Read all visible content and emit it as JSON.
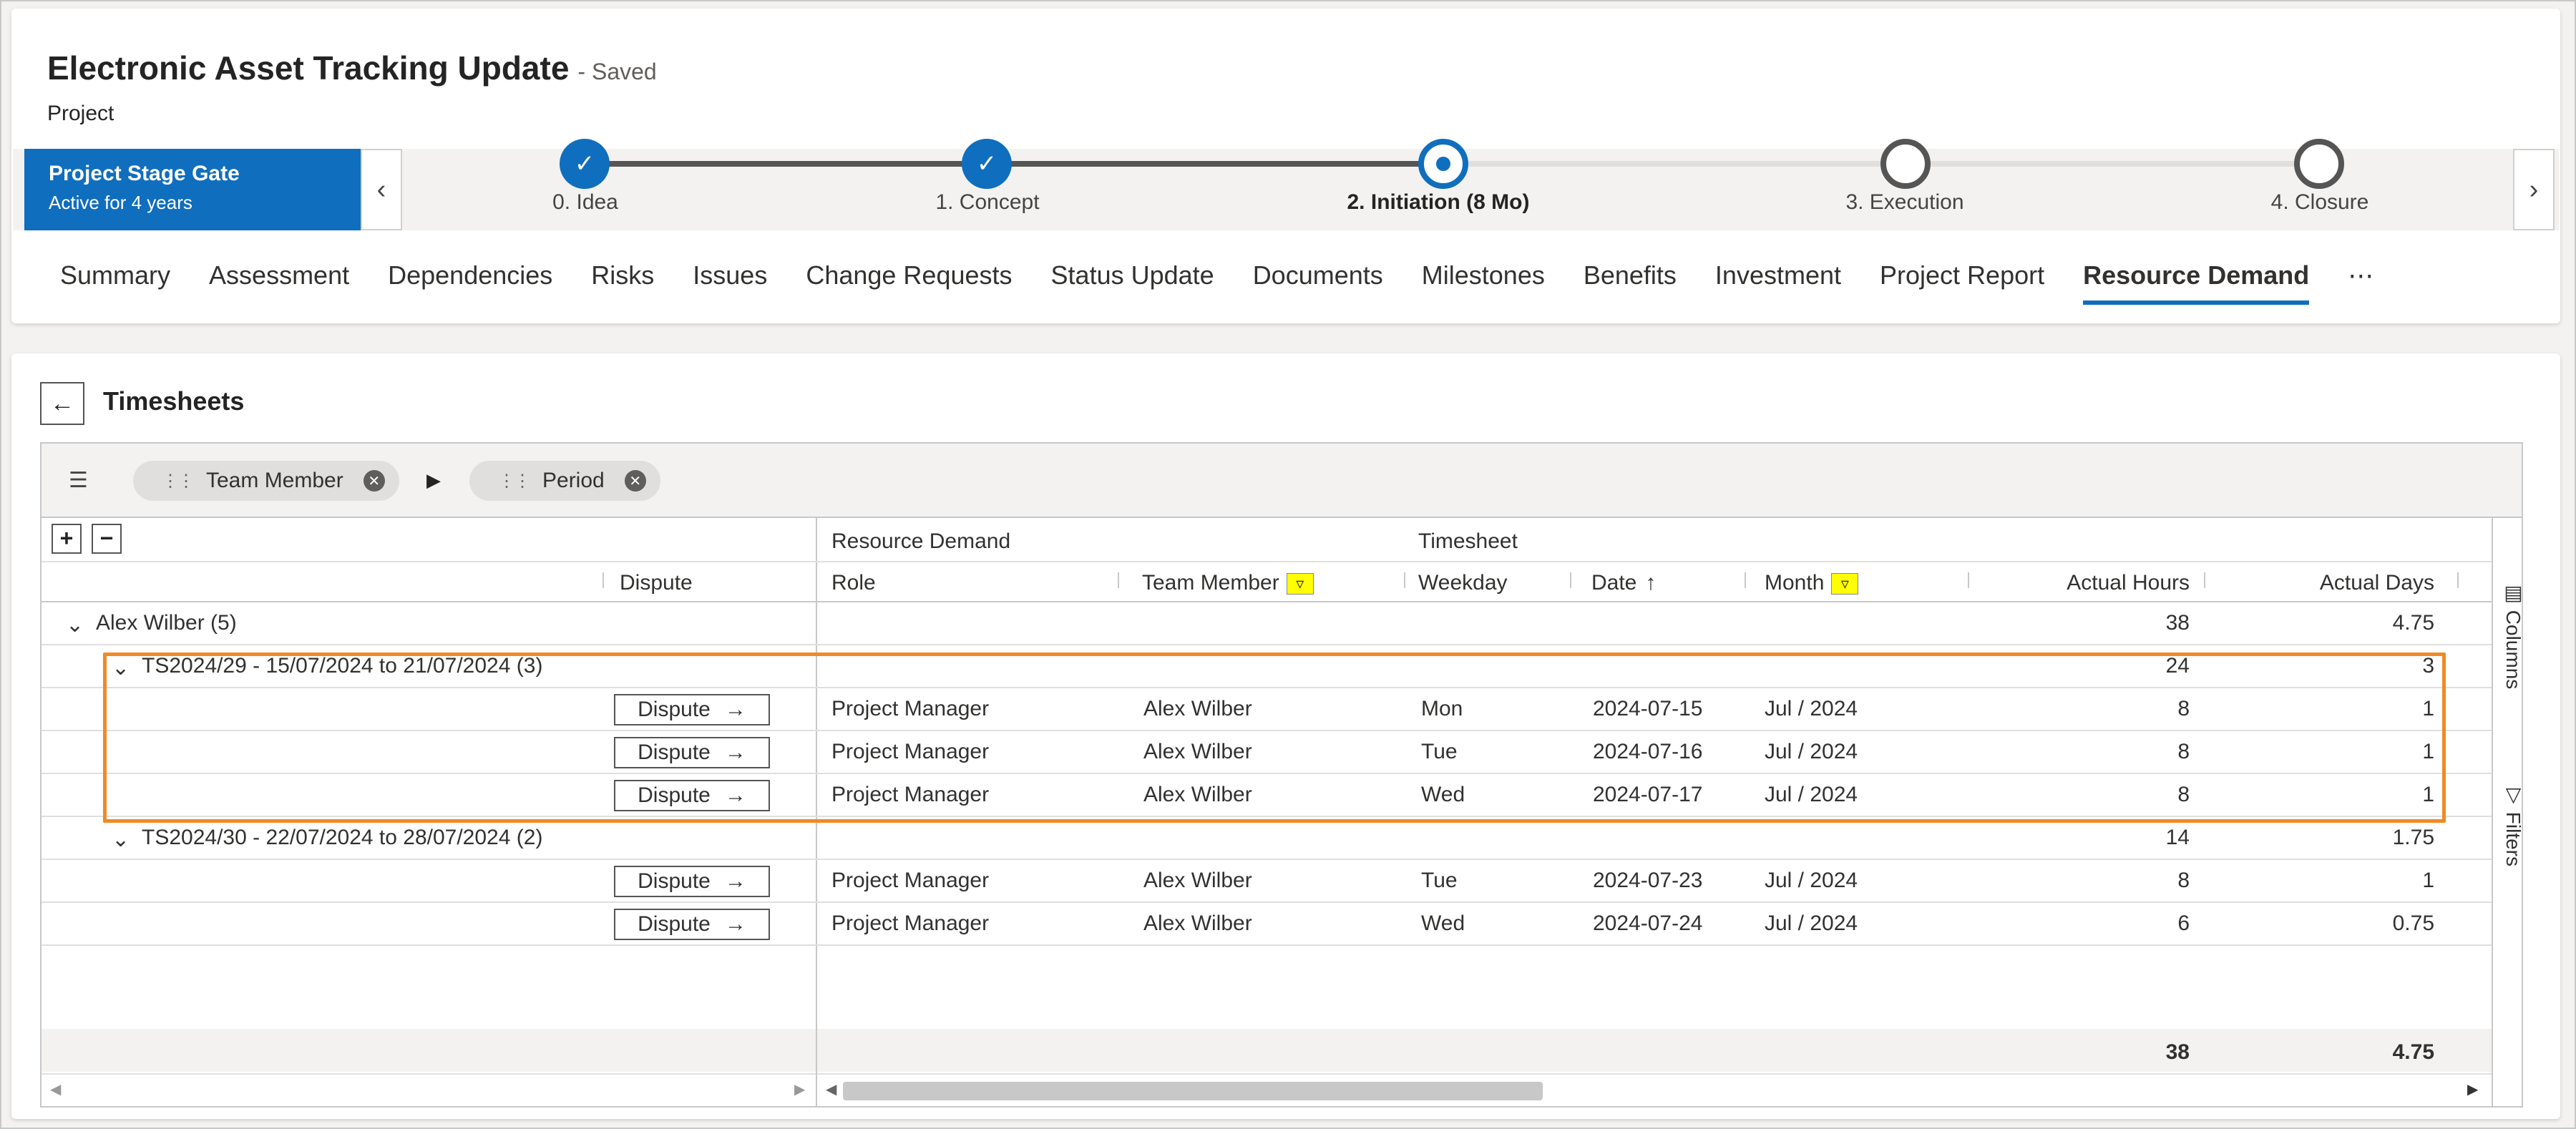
{
  "header": {
    "title": "Electronic Asset Tracking Update",
    "save_status": "- Saved",
    "entity": "Project"
  },
  "bpf": {
    "name": "Project Stage Gate",
    "active_for": "Active for 4 years",
    "prev_icon": "chevron-left-icon",
    "next_icon": "chevron-right-icon",
    "stages": [
      {
        "label": "0. Idea",
        "state": "done"
      },
      {
        "label": "1. Concept",
        "state": "done"
      },
      {
        "label": "2. Initiation  (8 Mo)",
        "state": "active"
      },
      {
        "label": "3. Execution",
        "state": "todo"
      },
      {
        "label": "4. Closure",
        "state": "todo"
      }
    ]
  },
  "tabs": [
    "Summary",
    "Assessment",
    "Dependencies",
    "Risks",
    "Issues",
    "Change Requests",
    "Status Update",
    "Documents",
    "Milestones",
    "Benefits",
    "Investment",
    "Project Report",
    "Resource Demand",
    "⋯"
  ],
  "active_tab": "Resource Demand",
  "section": {
    "back_icon": "arrow-left-icon",
    "title": "Timesheets"
  },
  "grouping": {
    "icon": "group-list-icon",
    "chips": [
      "Team Member",
      "Period"
    ]
  },
  "grid": {
    "expand_all": "+",
    "collapse_all": "−",
    "group_headers": {
      "resource_demand": "Resource Demand",
      "timesheet": "Timesheet"
    },
    "columns": {
      "dispute": "Dispute",
      "role": "Role",
      "team_member": "Team Member",
      "weekday": "Weekday",
      "date": "Date",
      "month": "Month",
      "actual_hours": "Actual Hours",
      "actual_days": "Actual Days"
    },
    "filter_icon": "filter-icon",
    "sort_icon": "sort-ascending-icon",
    "groups": [
      {
        "label": "Alex Wilber",
        "count": "(5)",
        "hours": "38",
        "days": "4.75"
      },
      {
        "label": "TS2024/29 - 15/07/2024 to 21/07/2024",
        "count": "(3)",
        "hours": "24",
        "days": "3"
      },
      {
        "label": "TS2024/30 - 22/07/2024 to 28/07/2024",
        "count": "(2)",
        "hours": "14",
        "days": "1.75"
      }
    ],
    "rows": [
      {
        "dispute": "Dispute",
        "role": "Project Manager",
        "member": "Alex Wilber",
        "weekday": "Mon",
        "date": "2024-07-15",
        "month": "Jul / 2024",
        "hours": "8",
        "days": "1"
      },
      {
        "dispute": "Dispute",
        "role": "Project Manager",
        "member": "Alex Wilber",
        "weekday": "Tue",
        "date": "2024-07-16",
        "month": "Jul / 2024",
        "hours": "8",
        "days": "1"
      },
      {
        "dispute": "Dispute",
        "role": "Project Manager",
        "member": "Alex Wilber",
        "weekday": "Wed",
        "date": "2024-07-17",
        "month": "Jul / 2024",
        "hours": "8",
        "days": "1"
      },
      {
        "dispute": "Dispute",
        "role": "Project Manager",
        "member": "Alex Wilber",
        "weekday": "Tue",
        "date": "2024-07-23",
        "month": "Jul / 2024",
        "hours": "8",
        "days": "1"
      },
      {
        "dispute": "Dispute",
        "role": "Project Manager",
        "member": "Alex Wilber",
        "weekday": "Wed",
        "date": "2024-07-24",
        "month": "Jul / 2024",
        "hours": "6",
        "days": "0.75"
      }
    ],
    "totals": {
      "hours": "38",
      "days": "4.75"
    }
  },
  "side_panel": {
    "columns": "Columns",
    "filters": "Filters"
  },
  "colors": {
    "accent": "#106ebe",
    "highlight": "#f08a24",
    "filter_active": "#ffff00"
  }
}
